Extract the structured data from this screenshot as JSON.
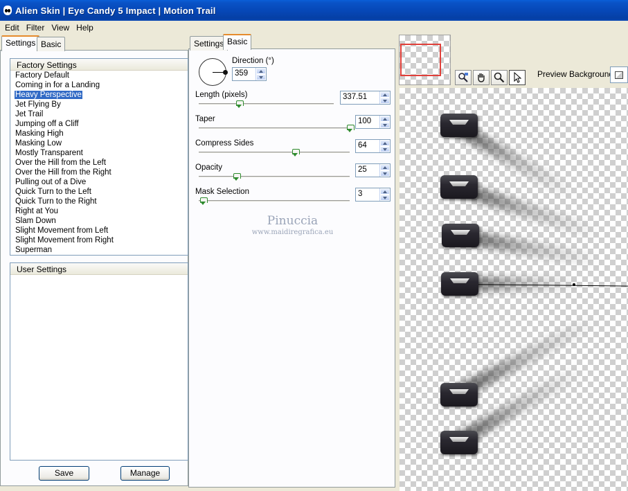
{
  "window": {
    "title": "Alien Skin | Eye Candy 5 Impact | Motion Trail"
  },
  "menu": [
    "Edit",
    "Filter",
    "View",
    "Help"
  ],
  "left_tabs": {
    "settings": "Settings",
    "basic": "Basic"
  },
  "factory_settings": {
    "header": "Factory Settings",
    "items": [
      "Factory Default",
      "Coming in for a Landing",
      "Heavy Perspective",
      "Jet Flying By",
      "Jet Trail",
      "Jumping off a Cliff",
      "Masking High",
      "Masking Low",
      "Mostly Transparent",
      "Over the Hill from the Left",
      "Over the Hill from the Right",
      "Pulling out of a Dive",
      "Quick Turn to the Left",
      "Quick Turn to the Right",
      "Right at You",
      "Slam Down",
      "Slight Movement from Left",
      "Slight Movement from Right",
      "Superman"
    ],
    "selected": "Heavy Perspective"
  },
  "user_settings": {
    "header": "User Settings"
  },
  "buttons": {
    "save": "Save",
    "manage": "Manage"
  },
  "mid_tabs": {
    "settings": "Settings",
    "basic": "Basic"
  },
  "params": {
    "direction": {
      "label": "Direction (°)",
      "value": "359"
    },
    "length": {
      "label": "Length (pixels)",
      "value": "337.51",
      "level": 0.3
    },
    "taper": {
      "label": "Taper",
      "value": "100",
      "level": 1.0
    },
    "compress": {
      "label": "Compress Sides",
      "value": "64",
      "level": 0.64
    },
    "opacity": {
      "label": "Opacity",
      "value": "25",
      "level": 0.25
    },
    "mask": {
      "label": "Mask Selection",
      "value": "3",
      "level": 0.03
    }
  },
  "watermark": {
    "name": "Pinuccia",
    "url": "www.maidiregrafica.eu"
  },
  "preview": {
    "background_label": "Preview Background:"
  },
  "colors": {
    "selection": "#316ac5",
    "titlebar": "#0648b8",
    "tab_accent": "#e68b2c"
  }
}
